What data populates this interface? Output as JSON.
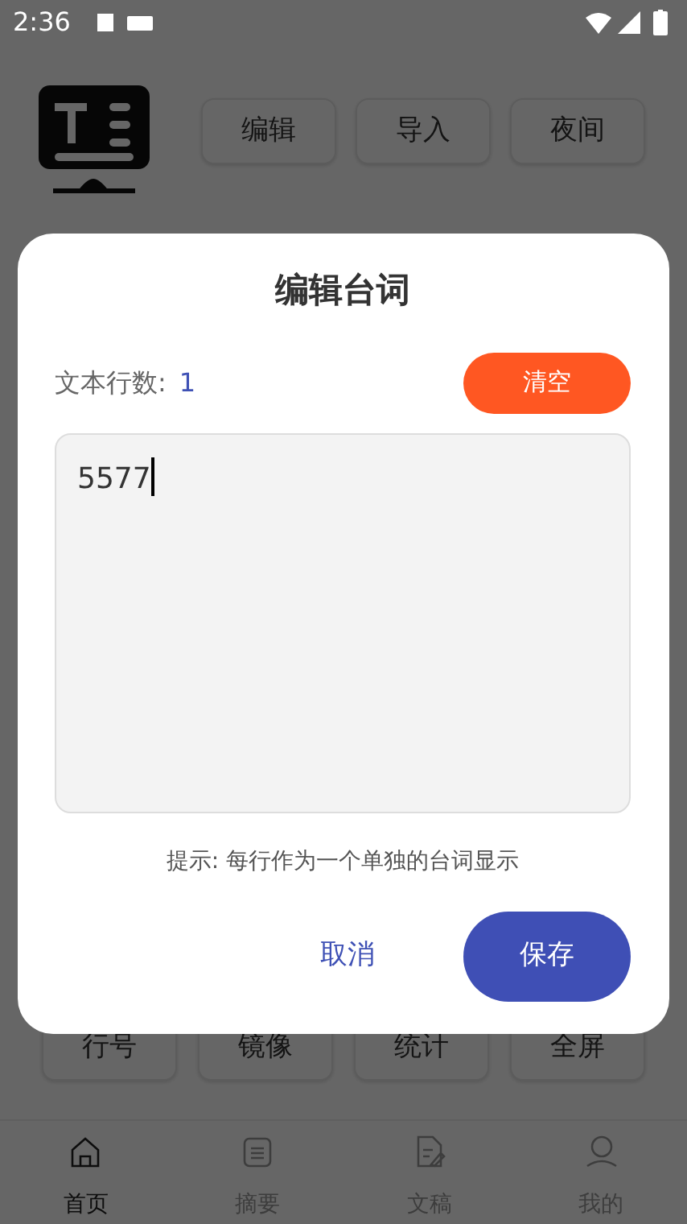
{
  "status_bar": {
    "time": "2:36"
  },
  "toolbar": {
    "buttons": [
      "编辑",
      "导入",
      "夜间"
    ]
  },
  "bottom_buttons": [
    "行号",
    "镜像",
    "统计",
    "全屏"
  ],
  "dialog": {
    "title": "编辑台词",
    "line_count_label": "文本行数:",
    "line_count": "1",
    "clear_button": "清空",
    "text": "5577",
    "hint": "提示: 每行作为一个单独的台词显示",
    "cancel_button": "取消",
    "save_button": "保存"
  },
  "nav": [
    {
      "label": "首页",
      "selected": true,
      "kind": "home"
    },
    {
      "label": "摘要",
      "selected": false,
      "kind": "summary"
    },
    {
      "label": "文稿",
      "selected": false,
      "kind": "document"
    },
    {
      "label": "我的",
      "selected": false,
      "kind": "profile"
    }
  ]
}
